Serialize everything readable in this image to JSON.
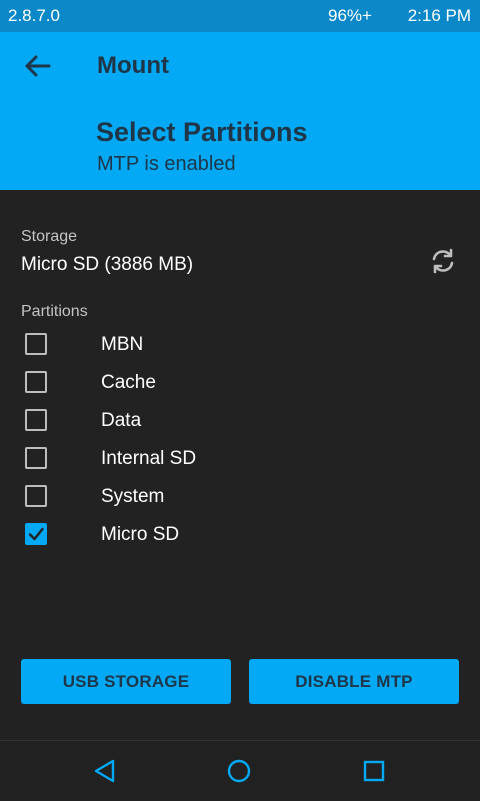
{
  "status_bar": {
    "version": "2.8.7.0",
    "battery": "96%+",
    "time": "2:16 PM"
  },
  "header": {
    "title": "Mount",
    "heading": "Select Partitions",
    "subtitle": "MTP is enabled"
  },
  "storage": {
    "label": "Storage",
    "value": "Micro SD (3886 MB)"
  },
  "partitions": {
    "label": "Partitions",
    "items": [
      {
        "name": "MBN",
        "checked": false
      },
      {
        "name": "Cache",
        "checked": false
      },
      {
        "name": "Data",
        "checked": false
      },
      {
        "name": "Internal SD",
        "checked": false
      },
      {
        "name": "System",
        "checked": false
      },
      {
        "name": "Micro SD",
        "checked": true
      }
    ]
  },
  "buttons": {
    "usb_storage": "USB STORAGE",
    "disable_mtp": "DISABLE MTP"
  },
  "colors": {
    "accent": "#03a9f4",
    "status_bar": "#0a88c8",
    "background": "#222222",
    "header_text": "#1f3548"
  },
  "icons": {
    "back": "arrow-left-icon",
    "refresh": "refresh-icon",
    "nav_back": "triangle-back-icon",
    "nav_home": "circle-home-icon",
    "nav_recents": "square-recents-icon"
  }
}
